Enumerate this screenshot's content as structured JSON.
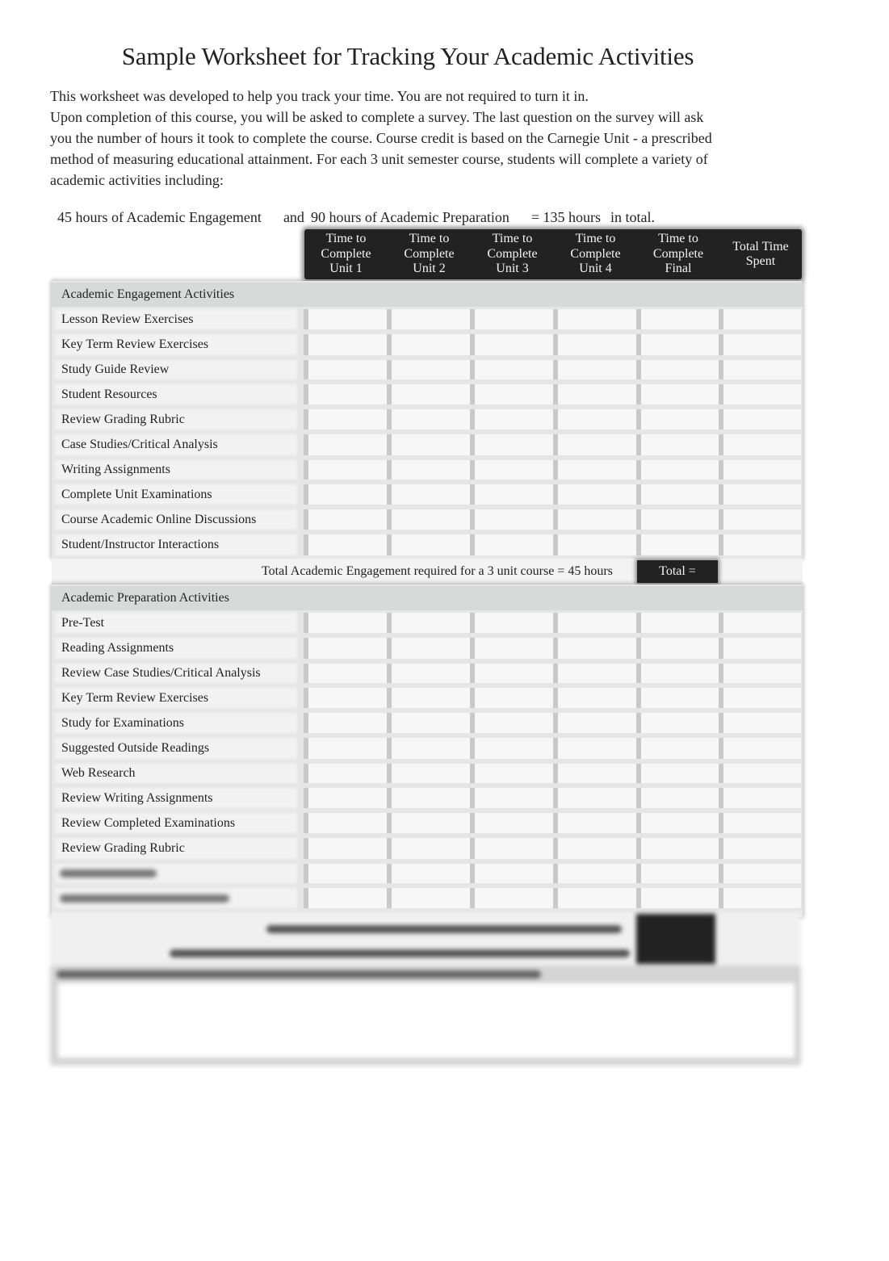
{
  "document": {
    "title": "Sample Worksheet for Tracking Your Academic Activities",
    "intro_lines": [
      "This worksheet was developed to help you track your time. You are not required to turn it in.",
      "Upon completion of this course, you will be asked to complete a survey. The last question on the survey will ask",
      "you the number of hours it took to complete the course. Course credit is based on the Carnegie Unit - a prescribed",
      "method of measuring educational attainment. For each 3 unit semester course, students will complete a variety of",
      "academic activities including:"
    ],
    "hours_summary": {
      "engagement": "45 hours of Academic Engagement",
      "and": "and",
      "preparation": "90 hours of Academic Preparation",
      "equals": "= 135 hours",
      "suffix": "in total."
    }
  },
  "table": {
    "columns": [
      "Time to\nComplete\nUnit 1",
      "Time to\nComplete\nUnit 2",
      "Time to\nComplete\nUnit 3",
      "Time to\nComplete\nUnit 4",
      "Time to\nComplete\nFinal",
      "Total Time\nSpent"
    ],
    "engagement": {
      "header": "Academic Engagement Activities",
      "rows": [
        "Lesson Review Exercises",
        "Key Term Review Exercises",
        "Study Guide Review",
        "Student Resources",
        "Review Grading Rubric",
        "Case Studies/Critical Analysis",
        "Writing Assignments",
        "Complete Unit Examinations",
        "Course Academic Online Discussions",
        "Student/Instructor Interactions"
      ],
      "total_text": "Total Academic Engagement required for a 3 unit course = 45 hours",
      "total_label": "Total ="
    },
    "preparation": {
      "header": "Academic Preparation Activities",
      "rows": [
        "Pre-Test",
        "Reading Assignments",
        "Review Case Studies/Critical Analysis",
        "Key Term Review Exercises",
        "Study for Examinations",
        "Suggested Outside Readings",
        "Web Research",
        "Review Writing Assignments",
        "Review Completed Examinations",
        "Review Grading Rubric",
        "",
        ""
      ]
    }
  }
}
